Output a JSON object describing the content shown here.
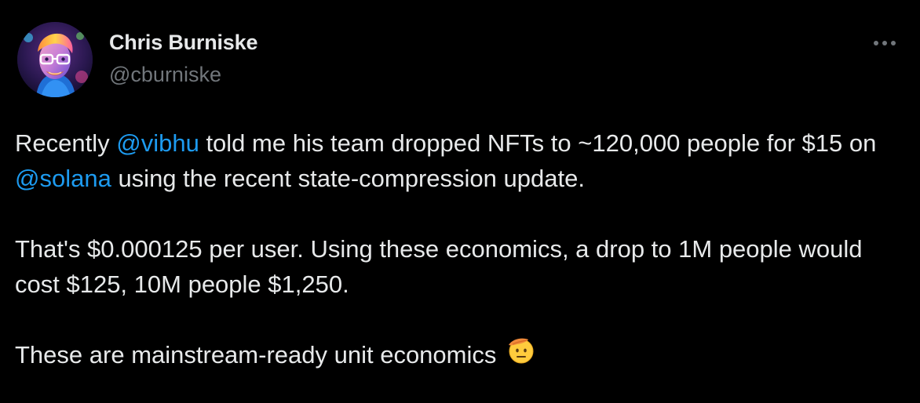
{
  "author": {
    "display_name": "Chris Burniske",
    "handle": "@cburniske",
    "avatar_icon": "profile-avatar"
  },
  "menu": {
    "more_icon": "more-horizontal-icon"
  },
  "tweet": {
    "p1": {
      "t1": "Recently ",
      "m1": "@vibhu",
      "t2": " told me his team dropped NFTs to ~120,000 people for $15 on ",
      "m2": "@solana",
      "t3": " using the recent state-compression update."
    },
    "p2": {
      "text": "That's $0.000125 per user. Using these economics, a drop to 1M people would cost $125, 10M people $1,250."
    },
    "p3": {
      "text": "These are mainstream-ready unit economics ",
      "emoji": "saluting-face-emoji"
    }
  },
  "colors": {
    "background": "#000000",
    "text": "#e7e9ea",
    "secondary_text": "#71767b",
    "link": "#1d9bf0"
  }
}
